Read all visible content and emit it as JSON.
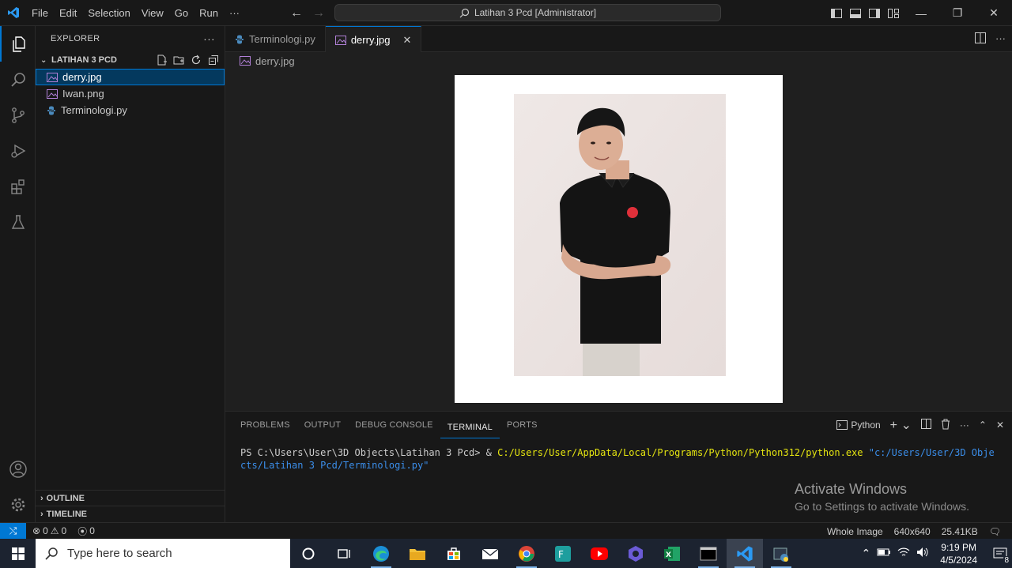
{
  "titlebar": {
    "menu": [
      "File",
      "Edit",
      "Selection",
      "View",
      "Go",
      "Run",
      "···"
    ],
    "command_center": "Latihan 3 Pcd [Administrator]"
  },
  "sidebar": {
    "title": "EXPLORER",
    "more": "···",
    "folder": "LATIHAN 3 PCD",
    "files": [
      {
        "name": "derry.jpg",
        "icon": "image-icon"
      },
      {
        "name": "Iwan.png",
        "icon": "image-icon"
      },
      {
        "name": "Terminologi.py",
        "icon": "python-icon"
      }
    ],
    "outline": "OUTLINE",
    "timeline": "TIMELINE"
  },
  "editor": {
    "tabs": [
      {
        "label": "Terminologi.py",
        "active": false
      },
      {
        "label": "derry.jpg",
        "active": true
      }
    ],
    "breadcrumb": "derry.jpg"
  },
  "panel": {
    "tabs": [
      "PROBLEMS",
      "OUTPUT",
      "DEBUG CONSOLE",
      "TERMINAL",
      "PORTS"
    ],
    "active_tab": "TERMINAL",
    "terminal_profile": "Python",
    "terminal": {
      "prompt": "PS C:\\Users\\User\\3D Objects\\Latihan 3 Pcd> ",
      "amp": "& ",
      "exe": "C:/Users/User/AppData/Local/Programs/Python/Python312/python.exe",
      "arg": "\"c:/Users/User/3D Objects/Latihan 3 Pcd/Terminologi.py\""
    },
    "watermark_title": "Activate Windows",
    "watermark_sub": "Go to Settings to activate Windows."
  },
  "statusbar": {
    "errors": "0",
    "warnings": "0",
    "ports": "0",
    "view_mode": "Whole Image",
    "dimensions": "640x640",
    "size": "25.41KB"
  },
  "taskbar": {
    "search_placeholder": "Type here to search",
    "time": "9:19 PM",
    "date": "4/5/2024",
    "notifications": "8"
  },
  "colors": {
    "accent": "#0078d4",
    "terminal_yellow": "#e5e510",
    "terminal_blue": "#3b8eea",
    "shirt": "#141414",
    "logo_red": "#e0303a"
  }
}
